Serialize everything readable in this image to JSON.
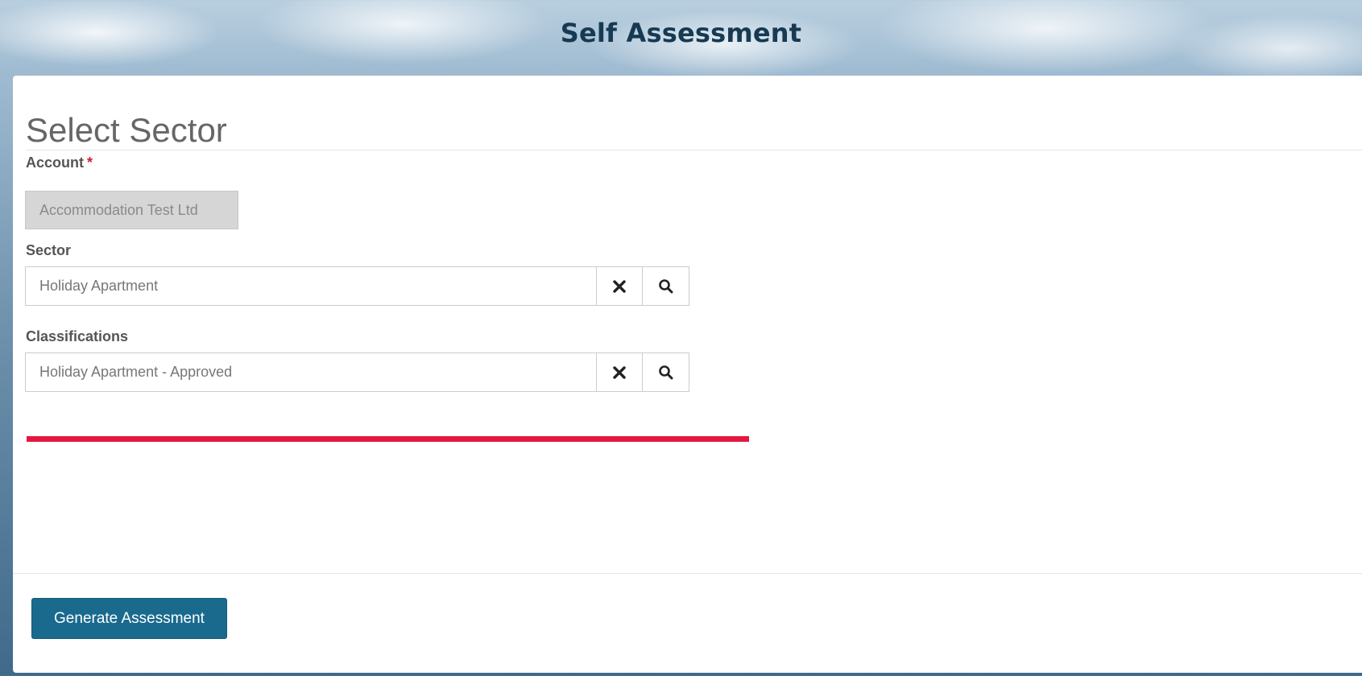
{
  "header": {
    "title": "Self Assessment"
  },
  "form": {
    "title": "Select Sector",
    "account": {
      "label": "Account",
      "required_mark": "*",
      "value": "Accommodation Test Ltd"
    },
    "sector": {
      "label": "Sector",
      "value": "Holiday Apartment",
      "clear_icon": "close-icon",
      "search_icon": "search-icon"
    },
    "classifications": {
      "label": "Classifications",
      "value": "Holiday Apartment - Approved",
      "clear_icon": "close-icon",
      "search_icon": "search-icon"
    }
  },
  "footer": {
    "generate_label": "Generate Assessment"
  },
  "colors": {
    "header_text": "#173a52",
    "primary_button": "#1a6a8e",
    "required": "#d21c2f",
    "highlight_bar": "#e3173e"
  }
}
